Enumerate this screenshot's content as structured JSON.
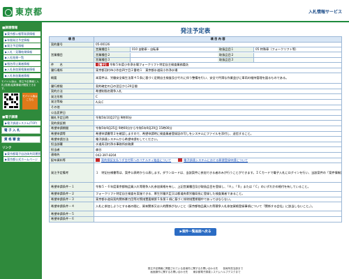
{
  "header": {
    "org_name": "東京都",
    "site_title": "入札情報サービス"
  },
  "sidebar": {
    "section1_title": "■調達情報",
    "links": [
      "▶東京都公報等発表情報",
      "▶年間発注予定情報",
      "▶発注予定情報",
      "▶入札・見積結果情報",
      "▶入札結果一覧",
      "▶指名停止業者情報",
      "▶入札参加資格業者情報",
      "▶入札参加業者情報"
    ],
    "mobile_note": "モバイル版は、発注予定情報と入札(見積)結果情報が閲覧できます。",
    "mobile_badge": "モバイル版はこちら",
    "section2_title": "■電子調達",
    "system_link": "▶電子調達システム(TOP)",
    "buttons": [
      "電 子 入 札",
      "資 格 審 査"
    ],
    "section3_title": "リンク",
    "footer_links": [
      "▶東京都電子自治体共同運営",
      "▶東京都公式ホームページ"
    ]
  },
  "page": {
    "title": "発注予定表",
    "col_item": "項 目",
    "col_content": "項 目 内 容"
  },
  "rows": {
    "contract_no": {
      "label": "契約番号",
      "value": "05-00126"
    },
    "business_category": {
      "label": "営業種目",
      "items": [
        {
          "k": "営業種目１",
          "v": "010 自動車・自転車",
          "k2": "取扱品目１",
          "v2": "05 特殊車（フォークリフト等）"
        },
        {
          "k": "営業種目２",
          "v": "",
          "k2": "取扱品目２",
          "v2": ""
        },
        {
          "k": "営業種目３",
          "v": "",
          "k2": "取扱品目３",
          "v2": ""
        }
      ]
    },
    "subject": {
      "label": "件　　名",
      "tag": "【電子】",
      "value": "令和５年度小作浄水場フォークリフト特定自主検査業務委託"
    },
    "place": {
      "label": "履行場所",
      "value": "東京都羽村市小作台四丁目２番地１　東京都水道局小作浄水場"
    },
    "summary": {
      "label": "概要",
      "value": "本案件は、労働安全衛生法第４５条に基づく定期自主検査及びそれに伴う整備を行い、安全で円滑な作業並びに車両の維持管理を図るものである。"
    },
    "period": {
      "label": "履行期限",
      "value": "契約確定の日の翌日から20日間"
    },
    "method": {
      "label": "契約方法",
      "value": "希望制指名競争入札"
    },
    "order_form": {
      "label": "発注形態",
      "value": "C"
    },
    "ranks": {
      "label": "発注等級",
      "value": "A,B,C"
    },
    "other": {
      "label": "その他",
      "value": ""
    },
    "announce_date": {
      "label": "公告変更日",
      "value": ""
    },
    "open_datetime": {
      "label": "開札予定日時",
      "value": "令和5年10月27日 9時00分"
    },
    "contract_period": {
      "label": "契約保証期",
      "value": ""
    },
    "apply_period": {
      "label": "希望申請期間",
      "value": "令和5年9月25日 9時00分から令和5年9月29日 15時00分"
    },
    "apply_conditions": {
      "label": "希望申請等",
      "value": "希望申請書等２を確認しますので、希望申請時に検査業者登録証の写しをシステムにファイルを添付し、送信すること。"
    },
    "apply_method": {
      "label": "希望申請方法",
      "value": "電子調達システムから希望申請をしてください。"
    },
    "contact_org": {
      "label": "担当部署",
      "value": "水道局羽村浄水事務所庶務課"
    },
    "contact_person": {
      "label": "担当者",
      "value": "森谷"
    },
    "phone": {
      "label": "連絡先",
      "value": "042-397-8204"
    },
    "attachments": {
      "label": "配布資料等",
      "link1": "契約保証支払うず言付率へのペナルティ抽出について",
      "link2": "電子調達システムにおける郵便登録申請について"
    },
    "conditions": {
      "label": "発注予定備考",
      "value": "１　特記仕様書等は、案件公表時から公表します。ダウンロードは、当該案件に参加できる者のみが行うことができます。ＩＣカードで電子入札にログインを行い、当該案件の「案件情報詳細」の「積算資料等」からダウンロードしてください。公表期間を過ぎますと、ダウンロードができなくなりますので注意してください。２　事業協同組合とその構成員が同一の案件に希望することはできません。"
    },
    "req1": {
      "label": "希望申請条件－１",
      "value": "令和５・６年度東京都物品買入れ等競争入札参加資格を有し、上記営業種目及び取扱品目を登録し、「Ａ」、「Ｂ」または「Ｃ」のいずれかの格付を有していること。"
    },
    "req2": {
      "label": "希望申請条件－２",
      "value": "フォークリフト特定自主検査を実施できる、厚生労働大臣又は都道府県労働局長に登録した検査業者であること。"
    },
    "req3": {
      "label": "希望申請条件－３",
      "value": "東京都水道局契約関係暴力団等対策措置要綱第５条第１項に基づく排除措置期間中であってはならない。"
    },
    "req4": {
      "label": "希望申請条件－４",
      "value": "入札に参加しようとする者の間に、資本関係又は人的関係がないこと（東京都物品買入れ等競争入札参加資格登録事項について「関係する会社」に該当しないこと。）。"
    },
    "req5": {
      "label": "希望申請条件－５",
      "value": ""
    },
    "req6": {
      "label": "希望申請条件－６",
      "value": ""
    }
  },
  "back_button": "▶案件一覧画面へ戻る",
  "footer": {
    "line1": "発注予定情報に掲載されている各案件に関するお問い合わせ先　　各局所担当部まで",
    "line2": "画面操作に関するお問い合わせ先　　東京都電子調達システムヘルプデスクまで"
  }
}
